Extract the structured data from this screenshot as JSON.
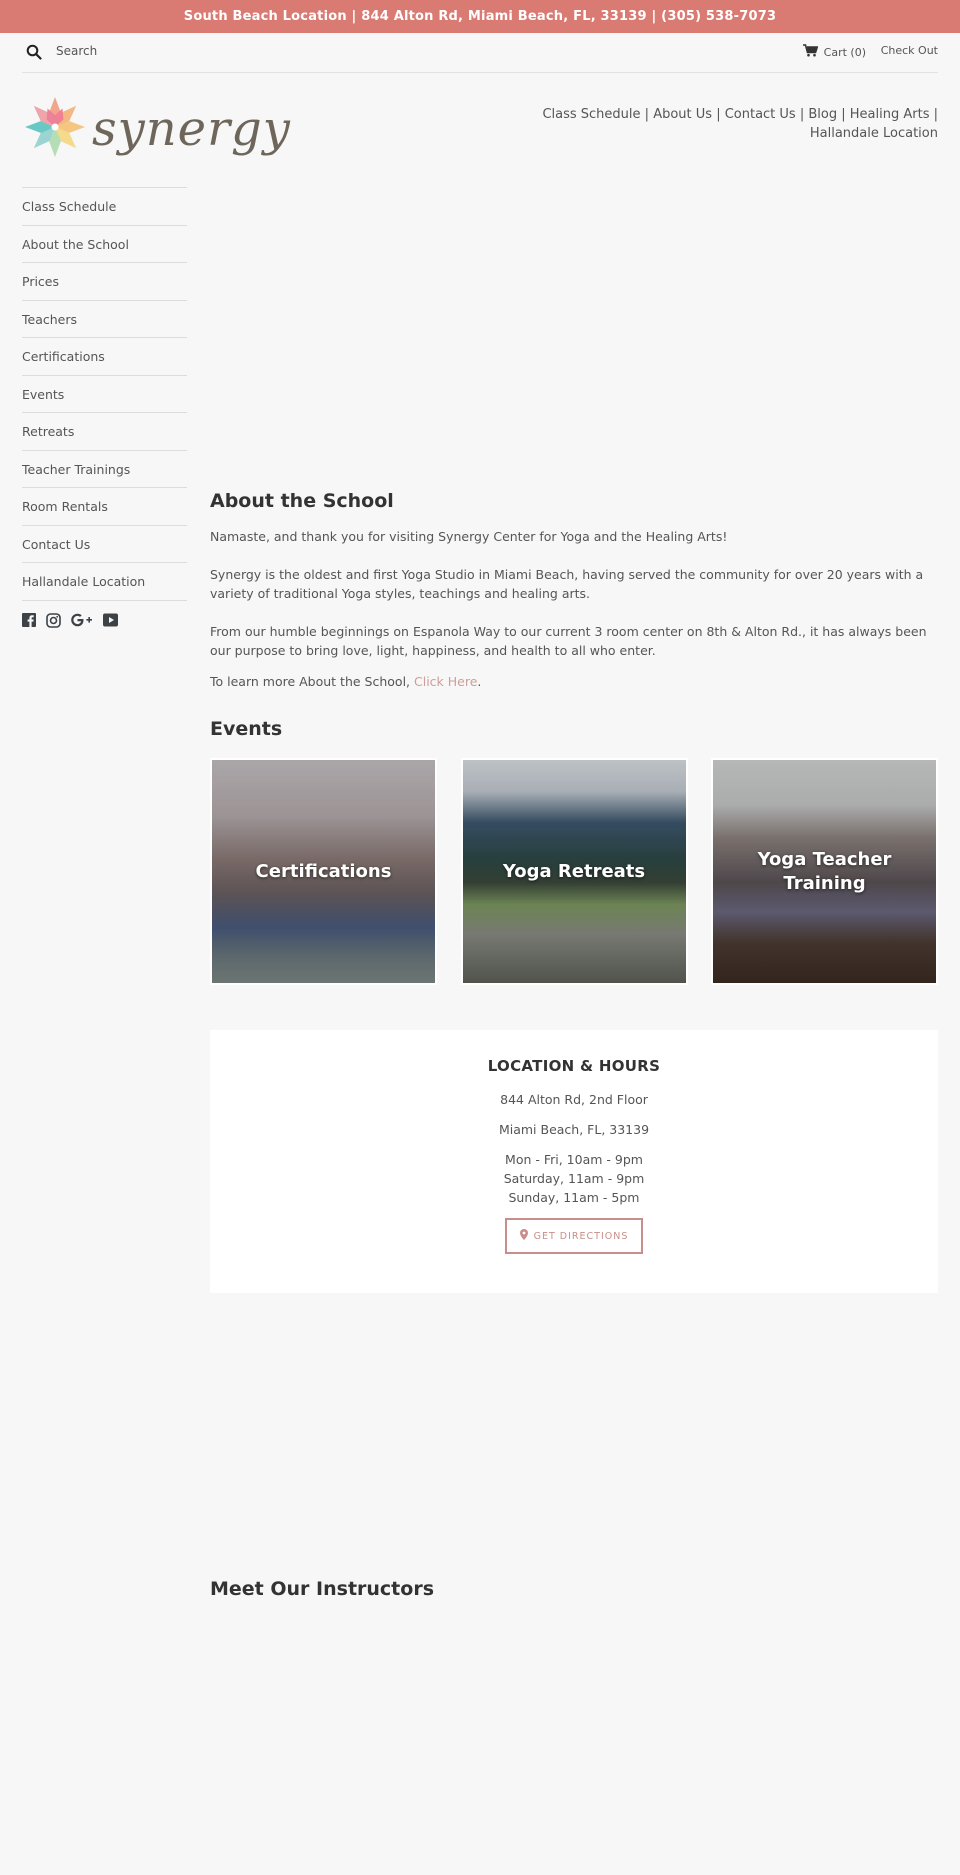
{
  "announcement": {
    "text": "South Beach Location | 844 Alton Rd, Miami Beach, FL, 33139 | (305) 538-7073",
    "bg_color": "#d97a73"
  },
  "topbar": {
    "search_placeholder": "Search",
    "search_icon": "search-icon",
    "cart_icon": "cart-icon",
    "cart_label": "Cart (0)",
    "checkout_label": "Check Out"
  },
  "logo": {
    "text": "synergy",
    "icon": "lotus-flower-icon"
  },
  "header_nav": {
    "items": [
      {
        "label": "Class Schedule"
      },
      {
        "label": "About Us"
      },
      {
        "label": "Contact Us"
      },
      {
        "label": "Blog"
      },
      {
        "label": "Healing Arts"
      },
      {
        "label": "Hallandale Location"
      }
    ],
    "separator": "|"
  },
  "sidebar": {
    "items": [
      {
        "label": "Class Schedule"
      },
      {
        "label": "About the School"
      },
      {
        "label": "Prices"
      },
      {
        "label": "Teachers"
      },
      {
        "label": "Certifications"
      },
      {
        "label": "Events"
      },
      {
        "label": "Retreats"
      },
      {
        "label": "Teacher Trainings"
      },
      {
        "label": "Room Rentals"
      },
      {
        "label": "Contact Us"
      },
      {
        "label": "Hallandale Location"
      }
    ],
    "social": [
      "facebook-icon",
      "instagram-icon",
      "google-plus-icon",
      "youtube-icon"
    ]
  },
  "about": {
    "title": "About the School",
    "p1": "Namaste, and thank you for visiting Synergy Center for Yoga and the Healing Arts!",
    "p2": "Synergy is the oldest and first Yoga Studio in Miami Beach, having served the community for over 20 years with a variety of traditional Yoga styles, teachings and healing arts.",
    "p3": "From our humble beginnings on Espanola Way to our current 3 room center on 8th & Alton Rd., it has always been our purpose to bring love, light, happiness, and health to all who enter.",
    "p4_prefix": "To learn more About the School, ",
    "p4_link": "Click Here",
    "p4_suffix": ".",
    "link_color": "#d09d99"
  },
  "events": {
    "title": "Events",
    "cards": [
      {
        "label": "Certifications"
      },
      {
        "label": "Yoga Retreats"
      },
      {
        "label": "Yoga Teacher Training"
      }
    ]
  },
  "location": {
    "title": "LOCATION & HOURS",
    "address_line1": "844 Alton Rd, 2nd Floor",
    "address_line2": "Miami Beach, FL, 33139",
    "hours": [
      "Mon - Fri, 10am - 9pm",
      "Saturday, 11am - 9pm",
      "Sunday, 11am - 5pm"
    ],
    "button_label": "GET DIRECTIONS",
    "button_icon": "map-pin-icon",
    "accent_color": "#c98e89"
  },
  "instructors": {
    "title": "Meet Our Instructors"
  }
}
